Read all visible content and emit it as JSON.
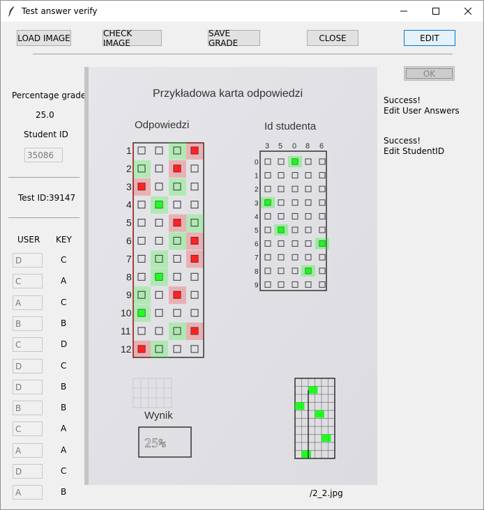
{
  "window": {
    "title": "Test answer verify",
    "controls": [
      "minimize-icon",
      "maximize-icon",
      "close-icon"
    ]
  },
  "toolbar": {
    "load_image": "LOAD IMAGE",
    "check_image": "CHECK IMAGE",
    "save_grade": "SAVE GRADE",
    "close": "CLOSE",
    "edit": "EDIT"
  },
  "left_panel": {
    "percentage_label": "Percentage grade",
    "percentage_value": "25.0",
    "student_id_label": "Student ID",
    "student_id_value": "35086",
    "test_id_label": "Test ID:",
    "test_id_value": "39147",
    "user_header": "USER",
    "key_header": "KEY",
    "answers": [
      {
        "user": "D",
        "key": "C"
      },
      {
        "user": "C",
        "key": "A"
      },
      {
        "user": "A",
        "key": "C"
      },
      {
        "user": "B",
        "key": "B"
      },
      {
        "user": "C",
        "key": "D"
      },
      {
        "user": "D",
        "key": "C"
      },
      {
        "user": "D",
        "key": "B"
      },
      {
        "user": "B",
        "key": "B"
      },
      {
        "user": "C",
        "key": "A"
      },
      {
        "user": "A",
        "key": "A"
      },
      {
        "user": "D",
        "key": "C"
      },
      {
        "user": "A",
        "key": "B"
      }
    ]
  },
  "right_panel": {
    "ok_label": "OK",
    "messages": [
      {
        "line1": "Success!",
        "line2": "Edit User Answers"
      },
      {
        "line1": "Success!",
        "line2": "Edit StudentID"
      }
    ],
    "file_name": "/2_2.jpg"
  },
  "sheet": {
    "title": "Przykładowa karta odpowiedzi",
    "answers_heading": "Odpowiedzi",
    "student_heading": "Id studenta",
    "id_digits": [
      "3",
      "5",
      "0",
      "8",
      "6"
    ],
    "question_numbers": [
      "1",
      "2",
      "3",
      "4",
      "5",
      "6",
      "7",
      "8",
      "9",
      "10",
      "11",
      "12"
    ],
    "id_rows": [
      "0",
      "1",
      "2",
      "3",
      "4",
      "5",
      "6",
      "7",
      "8",
      "9"
    ],
    "score_label": "Wynik",
    "score_value": "25%"
  },
  "colors": {
    "correct": "#00ff00",
    "wrong": "#ff0000",
    "accent": "#0078d7"
  }
}
